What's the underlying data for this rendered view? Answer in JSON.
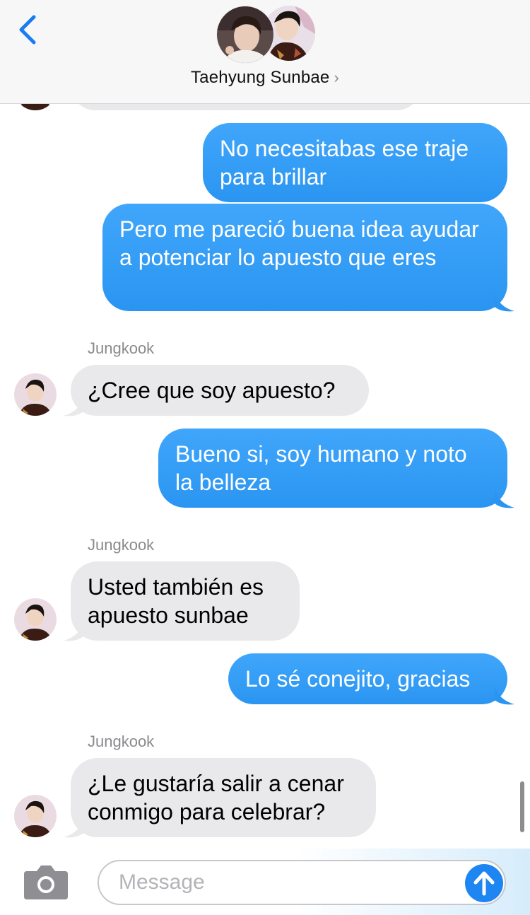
{
  "header": {
    "contact_name": "Taehyung Sunbae",
    "chevron": "›"
  },
  "messages": [
    {
      "direction": "out",
      "text": "No necesitabas ese traje para brillar"
    },
    {
      "direction": "out",
      "text": "Pero me pareció buena idea ayudar a potenciar lo apuesto que eres"
    },
    {
      "direction": "in",
      "sender": "Jungkook",
      "text": "¿Cree que soy apuesto?"
    },
    {
      "direction": "out",
      "text": "Bueno si, soy humano y noto la belleza"
    },
    {
      "direction": "in",
      "sender": "Jungkook",
      "text": "Usted también es apuesto sunbae"
    },
    {
      "direction": "out",
      "text": "Lo sé conejito, gracias"
    },
    {
      "direction": "in",
      "sender": "Jungkook",
      "text": "¿Le gustaría salir a cenar conmigo para celebrar?"
    }
  ],
  "composer": {
    "placeholder": "Message",
    "value": ""
  },
  "icons": {
    "back": "chevron-left-icon",
    "camera": "camera-icon",
    "send": "arrow-up-icon"
  },
  "colors": {
    "outgoing_bubble": "#2f9bf5",
    "incoming_bubble": "#e9e9eb",
    "accent": "#1e86f2"
  }
}
